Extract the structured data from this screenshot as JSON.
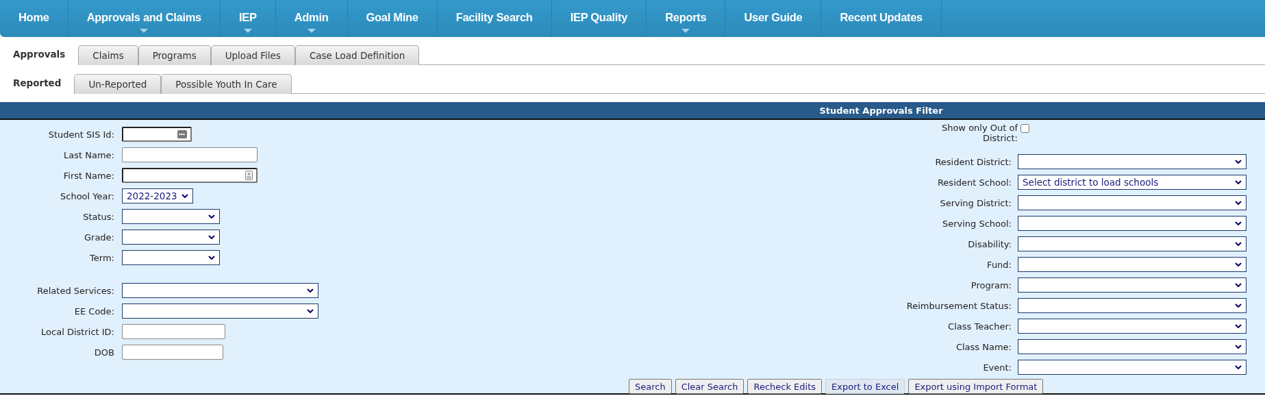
{
  "nav": [
    {
      "label": "Home",
      "dropdown": false
    },
    {
      "label": "Approvals and Claims",
      "dropdown": true
    },
    {
      "label": "IEP",
      "dropdown": true
    },
    {
      "label": "Admin",
      "dropdown": true
    },
    {
      "label": "Goal Mine",
      "dropdown": false
    },
    {
      "label": "Facility Search",
      "dropdown": false
    },
    {
      "label": "IEP Quality",
      "dropdown": false
    },
    {
      "label": "Reports",
      "dropdown": true
    },
    {
      "label": "User Guide",
      "dropdown": false
    },
    {
      "label": "Recent Updates",
      "dropdown": false
    }
  ],
  "tabs": [
    {
      "label": "Approvals",
      "selected": true
    },
    {
      "label": "Claims",
      "selected": false
    },
    {
      "label": "Programs",
      "selected": false
    },
    {
      "label": "Upload Files",
      "selected": false
    },
    {
      "label": "Case Load Definition",
      "selected": false
    }
  ],
  "subtabs": [
    {
      "label": "Reported",
      "selected": true
    },
    {
      "label": "Un-Reported",
      "selected": false
    },
    {
      "label": "Possible Youth In Care",
      "selected": false
    }
  ],
  "filter": {
    "title": "Student Approvals Filter",
    "left_groups": [
      [
        {
          "label": "Student SIS Id:",
          "kind": "lookup"
        },
        {
          "label": "Last Name:",
          "kind": "text"
        },
        {
          "label": "First Name:",
          "kind": "contact"
        },
        {
          "label": "School Year:",
          "kind": "select",
          "value": "2022-2023"
        },
        {
          "label": "Status:",
          "kind": "select"
        },
        {
          "label": "Grade:",
          "kind": "select"
        },
        {
          "label": "Term:",
          "kind": "select"
        }
      ],
      [
        {
          "label": "Related Services:",
          "kind": "select"
        },
        {
          "label": "EE Code:",
          "kind": "select"
        },
        {
          "label": "Local District ID:",
          "kind": "text"
        },
        {
          "label": "DOB",
          "kind": "text"
        }
      ]
    ],
    "right_fields": [
      {
        "label": "Show only Out of District:",
        "kind": "checkbox",
        "checked": false
      },
      {
        "label": "Resident District:",
        "kind": "select"
      },
      {
        "label": "Resident School:",
        "kind": "select",
        "value": "Select district to load schools"
      },
      {
        "label": "Serving District:",
        "kind": "select"
      },
      {
        "label": "Serving School:",
        "kind": "select"
      },
      {
        "label": "Disability:",
        "kind": "select"
      },
      {
        "label": "Fund:",
        "kind": "select"
      },
      {
        "label": "Program:",
        "kind": "select"
      },
      {
        "label": "Reimbursement Status:",
        "kind": "select"
      },
      {
        "label": "Class Teacher:",
        "kind": "select"
      },
      {
        "label": "Class Name:",
        "kind": "select"
      },
      {
        "label": "Event:",
        "kind": "select"
      }
    ],
    "buttons": [
      {
        "label": "Search",
        "disabled": false
      },
      {
        "label": "Clear Search",
        "disabled": false
      },
      {
        "label": "Recheck Edits",
        "disabled": false
      },
      {
        "label": "Export to Excel",
        "disabled": true
      },
      {
        "label": "Export using Import Format",
        "disabled": false
      }
    ]
  }
}
